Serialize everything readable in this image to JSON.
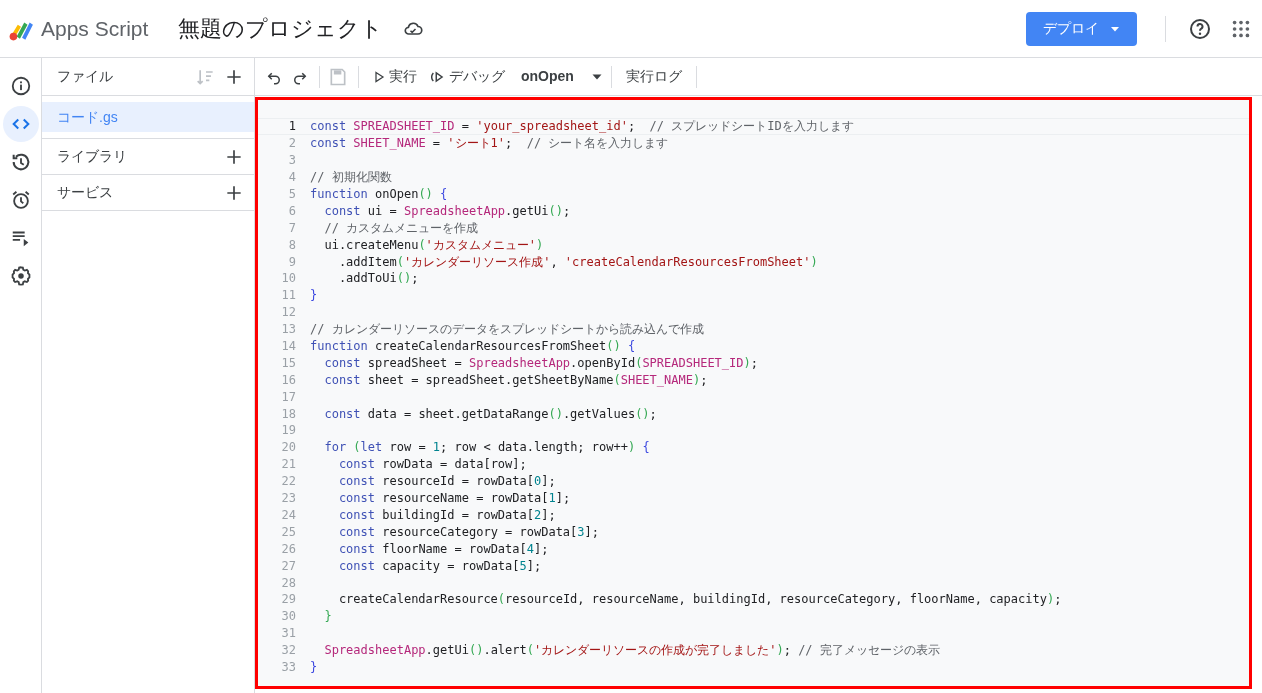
{
  "header": {
    "app_name": "Apps Script",
    "project_title": "無題のプロジェクト",
    "deploy_button": "デプロイ"
  },
  "rail": [
    {
      "kind": "info",
      "selected": false
    },
    {
      "kind": "code",
      "selected": true
    },
    {
      "kind": "history",
      "selected": false
    },
    {
      "kind": "triggers",
      "selected": false
    },
    {
      "kind": "executions",
      "selected": false
    },
    {
      "kind": "settings",
      "selected": false
    }
  ],
  "files_panel": {
    "title": "ファイル",
    "files": [
      {
        "name": "コード.gs",
        "selected": true
      }
    ],
    "sections": [
      {
        "label": "ライブラリ"
      },
      {
        "label": "サービス"
      }
    ]
  },
  "toolbar": {
    "save": {
      "disabled": true
    },
    "run": "実行",
    "debug": "デバッグ",
    "function_select": "onOpen",
    "log": "実行ログ"
  },
  "editor": {
    "lines": [
      {
        "no": "1",
        "current": true,
        "tokens": [
          {
            "kind": "keyword",
            "text": "const "
          },
          {
            "kind": "global",
            "text": "SPREADSHEET_ID"
          },
          {
            "kind": "plain",
            "text": " = "
          },
          {
            "kind": "string",
            "text": "'your_spreadsheet_id'"
          },
          {
            "kind": "plain",
            "text": ";  "
          },
          {
            "kind": "comment",
            "text": "// スプレッドシートIDを入力します"
          }
        ]
      },
      {
        "no": "2",
        "current": false,
        "tokens": [
          {
            "kind": "keyword",
            "text": "const "
          },
          {
            "kind": "global",
            "text": "SHEET_NAME"
          },
          {
            "kind": "plain",
            "text": " = "
          },
          {
            "kind": "string",
            "text": "'シート1'"
          },
          {
            "kind": "plain",
            "text": ";  "
          },
          {
            "kind": "comment",
            "text": "// シート名を入力します"
          }
        ]
      },
      {
        "no": "3",
        "current": false
      },
      {
        "no": "4",
        "current": false,
        "tokens": [
          {
            "kind": "comment",
            "text": "// 初期化関数"
          }
        ]
      },
      {
        "no": "5",
        "current": false,
        "tokens": [
          {
            "kind": "keyword",
            "text": "function"
          },
          {
            "kind": "plain",
            "text": " onOpen"
          },
          {
            "kind": "paren",
            "text": "() "
          },
          {
            "kind": "brace",
            "text": "{"
          }
        ]
      },
      {
        "no": "6",
        "current": false,
        "tokens": [
          {
            "kind": "keyword",
            "text": "  const"
          },
          {
            "kind": "plain",
            "text": " ui = "
          },
          {
            "kind": "global",
            "text": "SpreadsheetApp"
          },
          {
            "kind": "plain",
            "text": ".getUi"
          },
          {
            "kind": "paren",
            "text": "()"
          },
          {
            "kind": "plain",
            "text": ";"
          }
        ]
      },
      {
        "no": "7",
        "current": false,
        "tokens": [
          {
            "kind": "comment",
            "text": "  // カスタムメニューを作成"
          }
        ]
      },
      {
        "no": "8",
        "current": false,
        "tokens": [
          {
            "kind": "plain",
            "text": "  ui.createMenu"
          },
          {
            "kind": "paren",
            "text": "("
          },
          {
            "kind": "string",
            "text": "'カスタムメニュー'"
          },
          {
            "kind": "paren",
            "text": ")"
          }
        ]
      },
      {
        "no": "9",
        "current": false,
        "tokens": [
          {
            "kind": "plain",
            "text": "    .addItem"
          },
          {
            "kind": "paren",
            "text": "("
          },
          {
            "kind": "string",
            "text": "'カレンダーリソース作成'"
          },
          {
            "kind": "plain",
            "text": ", "
          },
          {
            "kind": "string",
            "text": "'createCalendarResourcesFromSheet'"
          },
          {
            "kind": "paren",
            "text": ")"
          }
        ]
      },
      {
        "no": "10",
        "current": false,
        "tokens": [
          {
            "kind": "plain",
            "text": "    .addToUi"
          },
          {
            "kind": "paren",
            "text": "()"
          },
          {
            "kind": "plain",
            "text": ";"
          }
        ]
      },
      {
        "no": "11",
        "current": false,
        "tokens": [
          {
            "kind": "brace",
            "text": "}"
          }
        ]
      },
      {
        "no": "12",
        "current": false
      },
      {
        "no": "13",
        "current": false,
        "tokens": [
          {
            "kind": "comment",
            "text": "// カレンダーリソースのデータをスプレッドシートから読み込んで作成"
          }
        ]
      },
      {
        "no": "14",
        "current": false,
        "tokens": [
          {
            "kind": "keyword",
            "text": "function"
          },
          {
            "kind": "plain",
            "text": " createCalendarResourcesFromSheet"
          },
          {
            "kind": "paren",
            "text": "() "
          },
          {
            "kind": "brace",
            "text": "{"
          }
        ]
      },
      {
        "no": "15",
        "current": false,
        "tokens": [
          {
            "kind": "keyword",
            "text": "  const"
          },
          {
            "kind": "plain",
            "text": " spreadSheet = "
          },
          {
            "kind": "global",
            "text": "SpreadsheetApp"
          },
          {
            "kind": "plain",
            "text": ".openById"
          },
          {
            "kind": "paren",
            "text": "("
          },
          {
            "kind": "global",
            "text": "SPREADSHEET_ID"
          },
          {
            "kind": "paren",
            "text": ")"
          },
          {
            "kind": "plain",
            "text": ";"
          }
        ]
      },
      {
        "no": "16",
        "current": false,
        "tokens": [
          {
            "kind": "keyword",
            "text": "  const"
          },
          {
            "kind": "plain",
            "text": " sheet = spreadSheet.getSheetByName"
          },
          {
            "kind": "paren",
            "text": "("
          },
          {
            "kind": "global",
            "text": "SHEET_NAME"
          },
          {
            "kind": "paren",
            "text": ")"
          },
          {
            "kind": "plain",
            "text": ";"
          }
        ]
      },
      {
        "no": "17",
        "current": false
      },
      {
        "no": "18",
        "current": false,
        "tokens": [
          {
            "kind": "keyword",
            "text": "  const"
          },
          {
            "kind": "plain",
            "text": " data = sheet.getDataRange"
          },
          {
            "kind": "paren",
            "text": "()"
          },
          {
            "kind": "plain",
            "text": ".getValues"
          },
          {
            "kind": "paren",
            "text": "()"
          },
          {
            "kind": "plain",
            "text": ";"
          }
        ]
      },
      {
        "no": "19",
        "current": false
      },
      {
        "no": "20",
        "current": false,
        "tokens": [
          {
            "kind": "keyword",
            "text": "  for "
          },
          {
            "kind": "paren",
            "text": "("
          },
          {
            "kind": "keyword",
            "text": "let"
          },
          {
            "kind": "plain",
            "text": " row = "
          },
          {
            "kind": "number",
            "text": "1"
          },
          {
            "kind": "plain",
            "text": "; row < data.length; row++"
          },
          {
            "kind": "paren",
            "text": ") "
          },
          {
            "kind": "brace",
            "text": "{"
          }
        ]
      },
      {
        "no": "21",
        "current": false,
        "tokens": [
          {
            "kind": "keyword",
            "text": "    const"
          },
          {
            "kind": "plain",
            "text": " rowData = data[row];"
          }
        ]
      },
      {
        "no": "22",
        "current": false,
        "tokens": [
          {
            "kind": "keyword",
            "text": "    const"
          },
          {
            "kind": "plain",
            "text": " resourceId = rowData["
          },
          {
            "kind": "number",
            "text": "0"
          },
          {
            "kind": "plain",
            "text": "];"
          }
        ]
      },
      {
        "no": "23",
        "current": false,
        "tokens": [
          {
            "kind": "keyword",
            "text": "    const"
          },
          {
            "kind": "plain",
            "text": " resourceName = rowData["
          },
          {
            "kind": "number",
            "text": "1"
          },
          {
            "kind": "plain",
            "text": "];"
          }
        ]
      },
      {
        "no": "24",
        "current": false,
        "tokens": [
          {
            "kind": "keyword",
            "text": "    const"
          },
          {
            "kind": "plain",
            "text": " buildingId = rowData["
          },
          {
            "kind": "number",
            "text": "2"
          },
          {
            "kind": "plain",
            "text": "];"
          }
        ]
      },
      {
        "no": "25",
        "current": false,
        "tokens": [
          {
            "kind": "keyword",
            "text": "    const"
          },
          {
            "kind": "plain",
            "text": " resourceCategory = rowData["
          },
          {
            "kind": "number",
            "text": "3"
          },
          {
            "kind": "plain",
            "text": "];"
          }
        ]
      },
      {
        "no": "26",
        "current": false,
        "tokens": [
          {
            "kind": "keyword",
            "text": "    const"
          },
          {
            "kind": "plain",
            "text": " floorName = rowData["
          },
          {
            "kind": "number",
            "text": "4"
          },
          {
            "kind": "plain",
            "text": "];"
          }
        ]
      },
      {
        "no": "27",
        "current": false,
        "tokens": [
          {
            "kind": "keyword",
            "text": "    const"
          },
          {
            "kind": "plain",
            "text": " capacity = rowData["
          },
          {
            "kind": "number",
            "text": "5"
          },
          {
            "kind": "plain",
            "text": "];"
          }
        ]
      },
      {
        "no": "28",
        "current": false
      },
      {
        "no": "29",
        "current": false,
        "tokens": [
          {
            "kind": "plain",
            "text": "    createCalendarResource"
          },
          {
            "kind": "paren",
            "text": "("
          },
          {
            "kind": "plain",
            "text": "resourceId, resourceName, buildingId, resourceCategory, floorName, capacity"
          },
          {
            "kind": "paren",
            "text": ")"
          },
          {
            "kind": "plain",
            "text": ";"
          }
        ]
      },
      {
        "no": "30",
        "current": false,
        "tokens": [
          {
            "kind": "paren",
            "text": "  }"
          }
        ]
      },
      {
        "no": "31",
        "current": false
      },
      {
        "no": "32",
        "current": false,
        "tokens": [
          {
            "kind": "global",
            "text": "  SpreadsheetApp"
          },
          {
            "kind": "plain",
            "text": ".getUi"
          },
          {
            "kind": "paren",
            "text": "()"
          },
          {
            "kind": "plain",
            "text": ".alert"
          },
          {
            "kind": "paren",
            "text": "("
          },
          {
            "kind": "string",
            "text": "'カレンダーリソースの作成が完了しました'"
          },
          {
            "kind": "paren",
            "text": ")"
          },
          {
            "kind": "plain",
            "text": "; "
          },
          {
            "kind": "comment",
            "text": "// 完了メッセージの表示"
          }
        ]
      },
      {
        "no": "33",
        "current": false,
        "tokens": [
          {
            "kind": "brace",
            "text": "}"
          }
        ]
      }
    ]
  }
}
